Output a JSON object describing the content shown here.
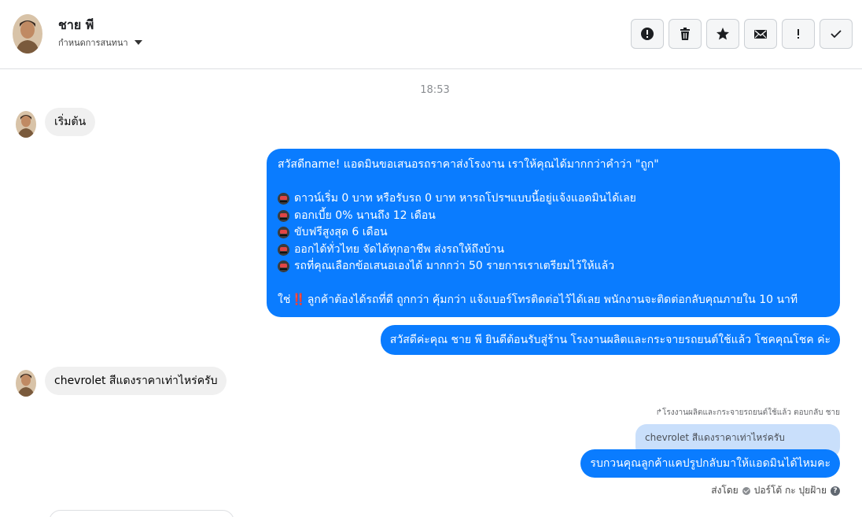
{
  "header": {
    "contact_name": "ชาย พี",
    "assign_label": "กำหนดการสนทนา"
  },
  "toolbar": {
    "buttons": [
      {
        "name": "spam-button",
        "icon": "alert-circle-icon"
      },
      {
        "name": "delete-button",
        "icon": "trash-icon"
      },
      {
        "name": "star-button",
        "icon": "star-icon"
      },
      {
        "name": "mark-unread-button",
        "icon": "envelope-icon"
      },
      {
        "name": "important-button",
        "icon": "exclamation-icon"
      },
      {
        "name": "done-button",
        "icon": "check-icon"
      }
    ]
  },
  "conversation": {
    "timestamp": "18:53",
    "messages": {
      "m1": {
        "text": "เริ่มต้น"
      },
      "m2": {
        "line1": "สวัสดีname! แอดมินขอเสนอรถราคาส่งโรงงาน เราให้คุณได้มากกว่าคำว่า \"ถูก\"",
        "bullets": [
          "ดาวน์เริ่ม 0 บาท หรือรับรถ 0 บาท หารถโปรฯแบบนี้อยู่แจ้งแอดมินได้เลย",
          "ดอกเบี้ย 0% นานถึง 12 เดือน",
          "ขับฟรีสูงสุด 6 เดือน",
          "ออกได้ทั่วไทย จัดได้ทุกอาชีพ ส่งรถให้ถึงบ้าน",
          "รถที่คุณเลือกข้อเสนอเองได้ มากกว่า 50 รายการเราเตรียมไว้ให้แล้ว"
        ],
        "last_prefix": "ใช่",
        "last_mark": "‼️",
        "last_text": "ลูกค้าต้องได้รถที่ดี ถูกกว่า คุ้มกว่า แจ้งเบอร์โทรติดต่อไว้ได้เลย พนักงานจะติดต่อกลับคุณภายใน 10 นาที"
      },
      "m3": {
        "text": "สวัสดีค่ะคุณ ชาย พี ยินดีต้อนรับสู่ร้าน โรงงานผลิตและกระจายรถยนต์ใช้แล้ว โชคคุณโชค ค่ะ"
      },
      "m4": {
        "text": "chevrolet สีแดงราคาเท่าไหร่ครับ"
      },
      "reply_meta": "↱โรงงานผลิตและกระจายรถยนต์ใช้แล้ว ตอบกลับ ชาย",
      "reply_quote": "chevrolet สีแดงราคาเท่าไหร่ครับ",
      "m5": {
        "text": "รบกวนคุณลูกค้าแคปรูปกลับมาให้แอดมินได้ไหมคะ"
      },
      "sent_by_label": "ส่งโดย",
      "sent_by_name": "ปอร์โต้ กะ ปุยฝ้าย"
    }
  },
  "colors": {
    "outgoing_bubble": "#0a7cff",
    "incoming_bubble": "#f0f0f0",
    "reply_quote_bg": "#c9dffb"
  }
}
